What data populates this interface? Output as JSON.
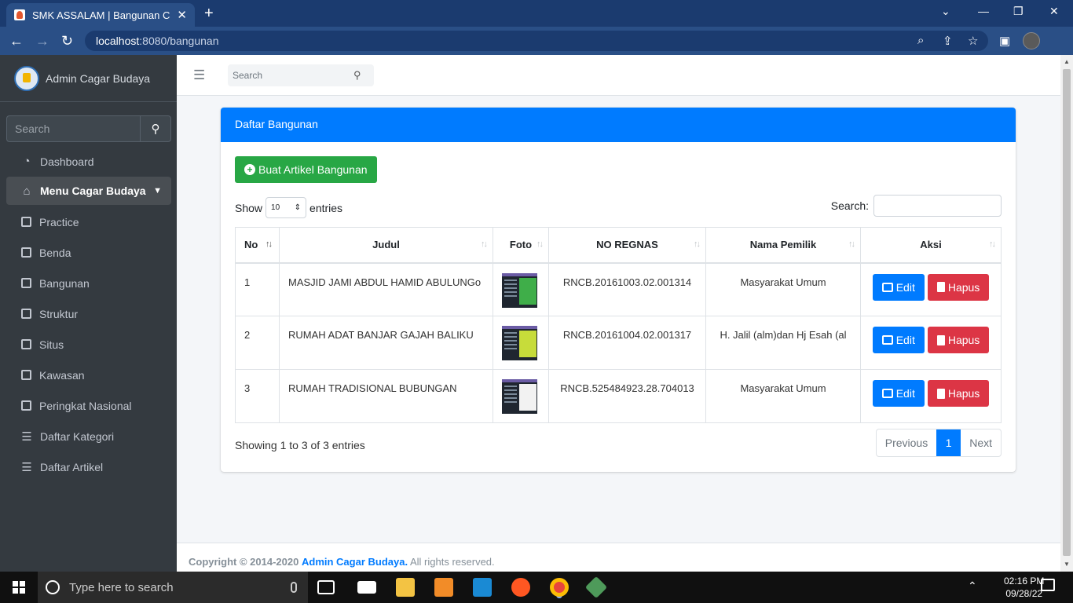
{
  "browser": {
    "tab_title": "SMK ASSALAM | Bangunan Cagar",
    "tab_close": "✕",
    "new_tab": "+",
    "url_host": "localhost",
    "url_path": ":8080/bangunan"
  },
  "sidebar": {
    "brand": "Admin Cagar Budaya",
    "search_placeholder": "Search",
    "items": [
      {
        "label": "Dashboard",
        "icon": "dashboard-icon"
      },
      {
        "label": "Menu Cagar Budaya",
        "icon": "home-icon"
      },
      {
        "label": "Practice",
        "icon": "square-icon"
      },
      {
        "label": "Benda",
        "icon": "square-icon"
      },
      {
        "label": "Bangunan",
        "icon": "square-icon"
      },
      {
        "label": "Struktur",
        "icon": "square-icon"
      },
      {
        "label": "Situs",
        "icon": "square-icon"
      },
      {
        "label": "Kawasan",
        "icon": "square-icon"
      },
      {
        "label": "Peringkat Nasional",
        "icon": "square-icon"
      },
      {
        "label": "Daftar Kategori",
        "icon": "list-icon"
      },
      {
        "label": "Daftar Artikel",
        "icon": "list-icon"
      }
    ]
  },
  "topbar": {
    "search_placeholder": "Search"
  },
  "card": {
    "title": "Daftar Bangunan",
    "create_button": "Buat Artikel Bangunan",
    "show_label": "Show",
    "entries_value": "10",
    "entries_label": "entries",
    "search_label": "Search:",
    "columns": [
      "No",
      "Judul",
      "Foto",
      "NO REGNAS",
      "Nama Pemilik",
      "Aksi"
    ],
    "rows": [
      {
        "no": "1",
        "judul": "MASJID JAMI ABDUL HAMID ABULUNGo",
        "regnas": "RNCB.20161003.02.001314",
        "pemilik": "Masyarakat Umum"
      },
      {
        "no": "2",
        "judul": "RUMAH ADAT BANJAR GAJAH BALIKU",
        "regnas": "RNCB.20161004.02.001317",
        "pemilik": "H. Jalil (alm)dan Hj Esah (al"
      },
      {
        "no": "3",
        "judul": "RUMAH TRADISIONAL BUBUNGAN",
        "regnas": "RNCB.525484923.28.704013",
        "pemilik": "Masyarakat Umum"
      }
    ],
    "edit_label": "Edit",
    "delete_label": "Hapus",
    "info": "Showing 1 to 3 of 3 entries",
    "pager": {
      "previous": "Previous",
      "current": "1",
      "next": "Next"
    }
  },
  "footer": {
    "copyright": "Copyright © 2014-2020",
    "brand": "Admin Cagar Budaya.",
    "rights": "All rights reserved."
  },
  "taskbar": {
    "search_placeholder": "Type here to search",
    "time": "02:16 PM",
    "date": "09/28/22"
  },
  "colors": {
    "primary": "#007bff",
    "success": "#28a745",
    "danger": "#dc3545",
    "sidebar": "#343a40"
  }
}
